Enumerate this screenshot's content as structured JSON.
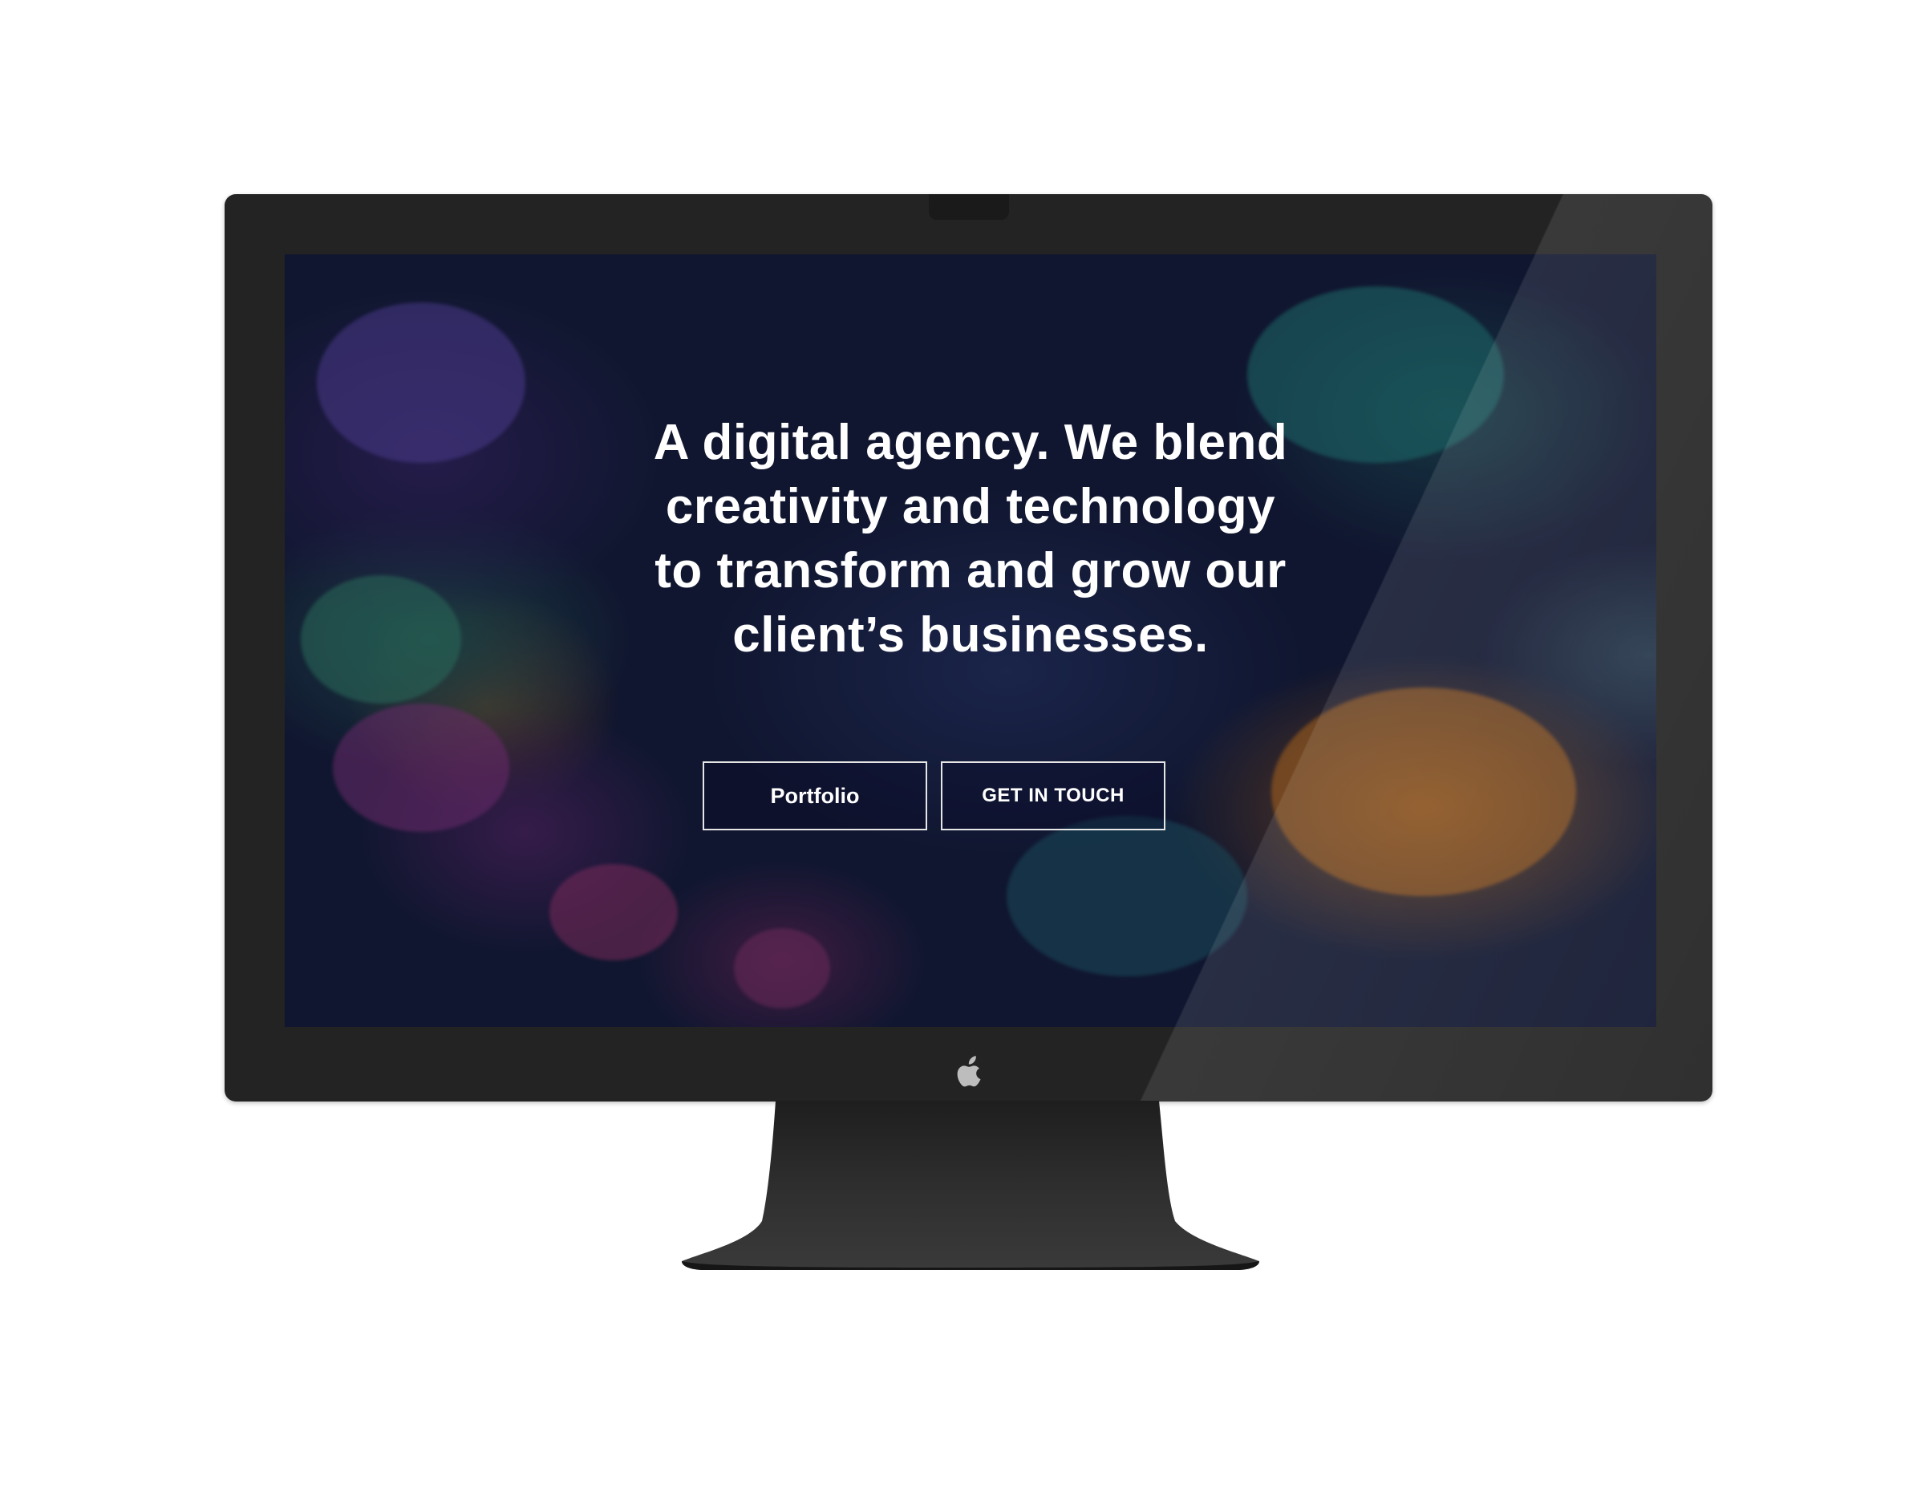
{
  "hero": {
    "headline": "A digital agency. We blend creativity and technology to transform and grow our client’s businesses.",
    "buttons": {
      "portfolio_label": "Portfolio",
      "get_in_touch_label": "GET IN TOUCH"
    }
  },
  "device": {
    "logo_icon": "apple-logo-icon",
    "bezel_color": "#232323",
    "stand_color": "#2b2b2b"
  },
  "colors": {
    "page_background": "#ffffff",
    "text": "#ffffff",
    "button_border": "#e6e6e6"
  }
}
